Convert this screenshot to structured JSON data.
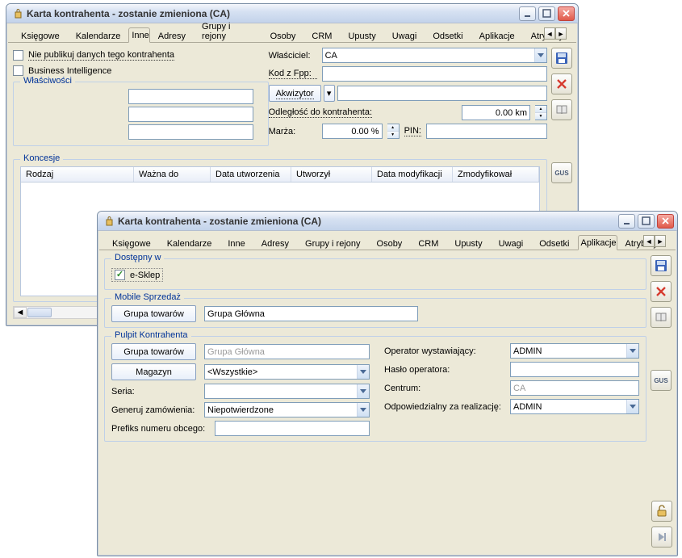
{
  "window_title": "Karta kontrahenta - zostanie zmieniona (CA)",
  "tabs": {
    "ksiegowe": "Księgowe",
    "kalendarze": "Kalendarze",
    "inne": "Inne",
    "adresy": "Adresy",
    "grupy": "Grupy i rejony",
    "osoby": "Osoby",
    "crm": "CRM",
    "upusty": "Upusty",
    "uwagi": "Uwagi",
    "odsetki": "Odsetki",
    "aplikacje": "Aplikacje",
    "atrybuty": "Atrybuty"
  },
  "inne": {
    "cb_niepublikuj": "Nie publikuj danych tego kontrahenta",
    "cb_bi": "Business Intelligence",
    "fs_wlasc": "Właściwości",
    "fs_koncesje": "Koncesje",
    "lbl_wlasciciel": "Właściciel:",
    "val_wlasciciel": "CA",
    "lbl_kod": "Kod z Fpp:",
    "val_kod": "",
    "btn_akwizytor": "Akwizytor",
    "val_akwizytor": "",
    "lbl_odleglosc": "Odległość do kontrahenta:",
    "val_odleglosc": "0.00 km",
    "lbl_marza": "Marża:",
    "val_marza": "0.00 %",
    "lbl_pin": "PIN:",
    "val_pin": "",
    "koncesje_cols": {
      "rodzaj": "Rodzaj",
      "wazna": "Ważna do",
      "datau": "Data utworzenia",
      "utworzyl": "Utworzył",
      "datam": "Data modyfikacji",
      "zmod": "Zmodyfikował"
    }
  },
  "apl": {
    "fs_dostepny": "Dostępny w",
    "cb_esklep": "e-Sklep",
    "fs_mobile": "Mobile Sprzedaż",
    "btn_grupa": "Grupa towarów",
    "val_grupa_mobile": "Grupa Główna",
    "fs_pulpit": "Pulpit Kontrahenta",
    "val_grupa_pulpit": "Grupa Główna",
    "btn_magazyn": "Magazyn",
    "val_magazyn": "<Wszystkie>",
    "lbl_seria": "Seria:",
    "val_seria": "",
    "lbl_generuj": "Generuj zamówienia:",
    "val_generuj": "Niepotwierdzone",
    "lbl_prefiks": "Prefiks numeru obcego:",
    "val_prefiks": "",
    "lbl_operator": "Operator wystawiający:",
    "val_operator": "ADMIN",
    "lbl_haslo": "Hasło operatora:",
    "val_haslo": "",
    "lbl_centrum": "Centrum:",
    "val_centrum": "CA",
    "lbl_odpow": "Odpowiedzialny za realizację:",
    "val_odpow": "ADMIN"
  },
  "side": {
    "gus": "GUS"
  }
}
